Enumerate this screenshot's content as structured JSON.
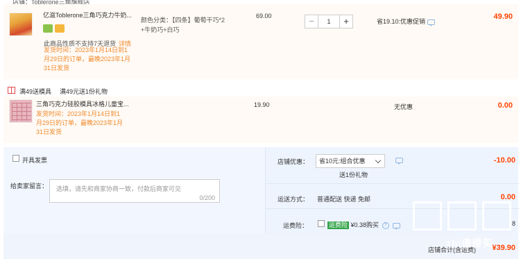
{
  "top_partial": "店铺：Toblerone三角旗舰店",
  "items": [
    {
      "name": "亿滋Toblerone三角巧克力牛奶...",
      "notice": "此商品性质不支持7天退货",
      "notice_link": "详情",
      "ship_lines": [
        "发货时间：2023年1月14日到1",
        "月29日的订单，最晚2023年1月",
        "31日发货"
      ],
      "spec_lines": [
        "颜色分类：【四条】葡萄干巧*2",
        "+牛奶巧+白巧"
      ],
      "price": "69.00",
      "qty": "1",
      "saving": "省19.10:优惠促销",
      "amount": "49.90"
    },
    {
      "name": "三角巧克力硅胶模具冰格儿童宝...",
      "ship_lines": [
        "发货时间：2023年1月14日到1",
        "月29日的订单，最晚2023年1月",
        "31日发货"
      ],
      "price": "19.90",
      "saving": "无优惠",
      "amount": "0.00"
    }
  ],
  "gift": {
    "label": "满49送模具",
    "desc": "满49元送1份礼物"
  },
  "invoice_label": "开具发票",
  "memo": {
    "label": "给卖家留言：",
    "placeholder": "选填，请先和商家协商一致，付款后商家可见",
    "count": "0/200"
  },
  "store_discount": {
    "label": "店铺优惠：",
    "select_value": "省10元:组合优惠",
    "sub": "送1份礼物",
    "amount": "-10.00"
  },
  "shipping": {
    "label": "运送方式：",
    "value": "普通配送 快递 免邮",
    "amount": "0.00"
  },
  "insurance": {
    "label": "运费险：",
    "tag": "运费险",
    "value": "¥0.38购买",
    "amount": "8"
  },
  "total": {
    "label": "店铺合计(含运费)",
    "amount": "¥39.90"
  },
  "watermark": "zhi值得买",
  "colors": {
    "accent": "#ff4400",
    "orange": "#f08a2c",
    "panel": "#eef4fe"
  }
}
